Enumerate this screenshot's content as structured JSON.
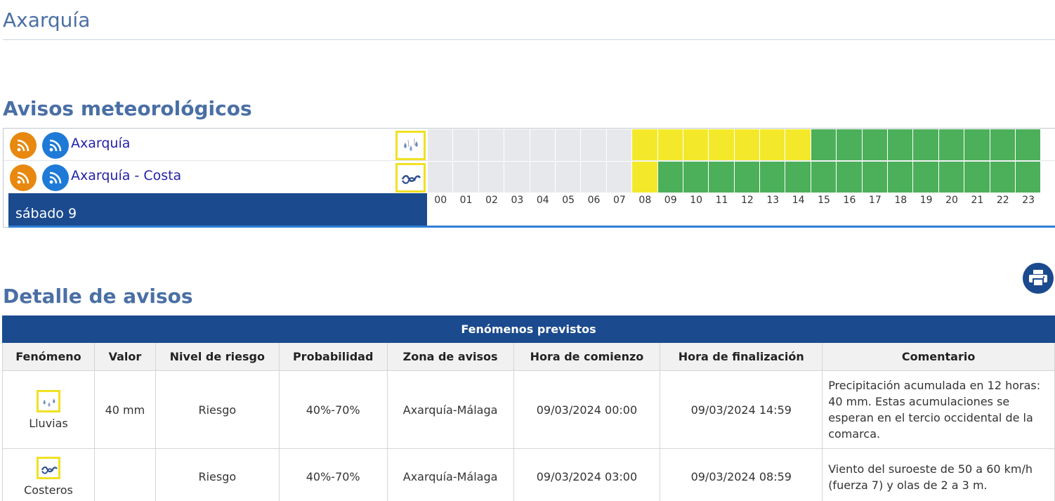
{
  "page": {
    "title": "Axarquía"
  },
  "avisos": {
    "heading": "Avisos meteorológicos",
    "rows": [
      {
        "zone": "Axarquía",
        "icon": "rain-drops-icon",
        "hours": [
          "gray",
          "gray",
          "gray",
          "gray",
          "gray",
          "gray",
          "gray",
          "gray",
          "yellow",
          "yellow",
          "yellow",
          "yellow",
          "yellow",
          "yellow",
          "yellow",
          "green",
          "green",
          "green",
          "green",
          "green",
          "green",
          "green",
          "green",
          "green"
        ]
      },
      {
        "zone": "Axarquía - Costa",
        "icon": "coastal-waves-icon",
        "hours": [
          "gray",
          "gray",
          "gray",
          "gray",
          "gray",
          "gray",
          "gray",
          "gray",
          "yellow",
          "green",
          "green",
          "green",
          "green",
          "green",
          "green",
          "green",
          "green",
          "green",
          "green",
          "green",
          "green",
          "green",
          "green",
          "green"
        ]
      }
    ],
    "day_label": "sábado 9",
    "hour_labels": [
      "00",
      "01",
      "02",
      "03",
      "04",
      "05",
      "06",
      "07",
      "08",
      "09",
      "10",
      "11",
      "12",
      "13",
      "14",
      "15",
      "16",
      "17",
      "18",
      "19",
      "20",
      "21",
      "22",
      "23"
    ],
    "colors": {
      "gray": "#e6e8eb",
      "yellow": "#f3e92a",
      "green": "#4caf5a",
      "rss_orange": "#e8880f",
      "rss_blue": "#1e7ad6",
      "bar_blue": "#1b4a8e"
    }
  },
  "detalle": {
    "heading": "Detalle de avisos",
    "table_caption": "Fenómenos previstos",
    "columns": [
      "Fenómeno",
      "Valor",
      "Nivel de riesgo",
      "Probabilidad",
      "Zona de avisos",
      "Hora de comienzo",
      "Hora de finalización",
      "Comentario"
    ],
    "rows": [
      {
        "fenomeno": "Lluvias",
        "icon": "rain-drops-icon",
        "valor": "40 mm",
        "nivel": "Riesgo",
        "probabilidad": "40%-70%",
        "zona": "Axarquía-Málaga",
        "comienzo": "09/03/2024 00:00",
        "fin": "09/03/2024 14:59",
        "comentario": "Precipitación acumulada en 12 horas: 40 mm. Estas acumulaciones se esperan en el tercio occidental de la comarca."
      },
      {
        "fenomeno": "Costeros",
        "icon": "coastal-waves-icon",
        "valor": "",
        "nivel": "Riesgo",
        "probabilidad": "40%-70%",
        "zona": "Axarquía-Málaga",
        "comienzo": "09/03/2024 03:00",
        "fin": "09/03/2024 08:59",
        "comentario": "Viento del suroeste de 50 a 60 km/h (fuerza 7) y olas de 2 a 3 m."
      }
    ]
  }
}
